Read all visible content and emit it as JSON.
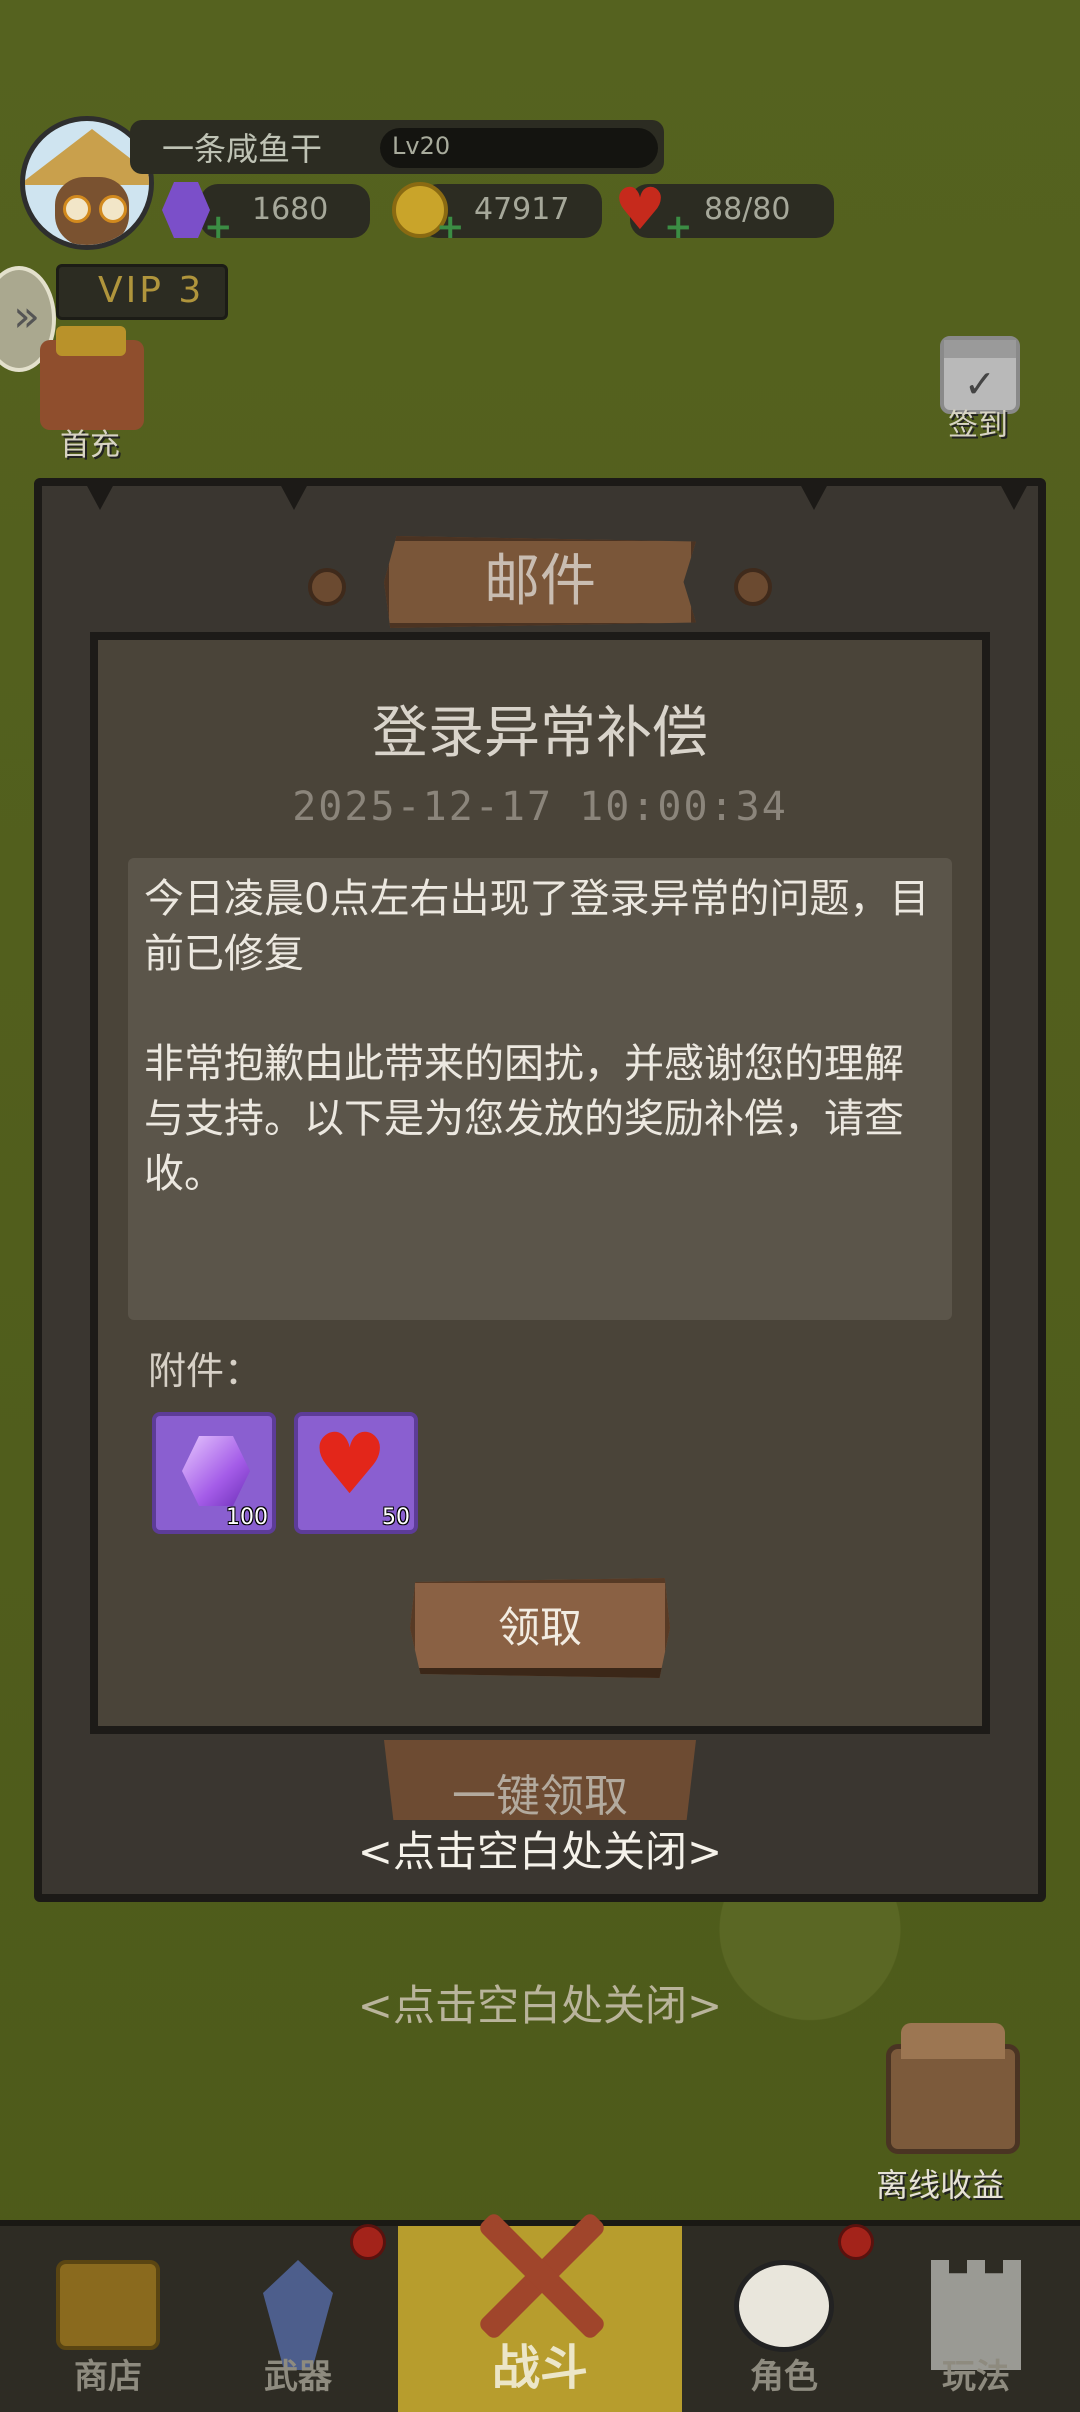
{
  "hud": {
    "player_name": "一条咸鱼干",
    "level": "Lv20",
    "gems": "1680",
    "coins": "47917",
    "stamina": "88/80",
    "vip": "VIP 3",
    "first_recharge_label": "首充",
    "sign_in_label": "签到"
  },
  "mail_dialog": {
    "header": "邮件",
    "title": "登录异常补偿",
    "datetime": "2025-12-17 10:00:34",
    "body_paragraph_1": "今日凌晨0点左右出现了登录异常的问题，目前已修复",
    "body_paragraph_2": "非常抱歉由此带来的困扰，并感谢您的理解与支持。以下是为您发放的奖励补偿，请查收。",
    "attachments_label": "附件：",
    "attachments": [
      {
        "icon": "purple-gem-icon",
        "count": "100"
      },
      {
        "icon": "heart-icon",
        "count": "50"
      }
    ],
    "claim_button": "领取",
    "claim_all_button": "一键领取",
    "close_hint": "<点击空白处关闭>"
  },
  "background": {
    "close_hint": "<点击空白处关闭>",
    "offline_income_label": "离线收益"
  },
  "bottom_nav": [
    {
      "label": "商店",
      "icon": "treasure-chest-icon"
    },
    {
      "label": "武器",
      "icon": "weapon-icon"
    },
    {
      "label": "战斗",
      "icon": "crossed-swords-icon",
      "active": true
    },
    {
      "label": "角色",
      "icon": "panda-icon"
    },
    {
      "label": "玩法",
      "icon": "tower-icon"
    }
  ],
  "colors": {
    "dialog_frame": "#3a3630",
    "dialog_inner": "#4a4439",
    "plank": "#7a5639",
    "active_tab": "#b79d2d"
  }
}
